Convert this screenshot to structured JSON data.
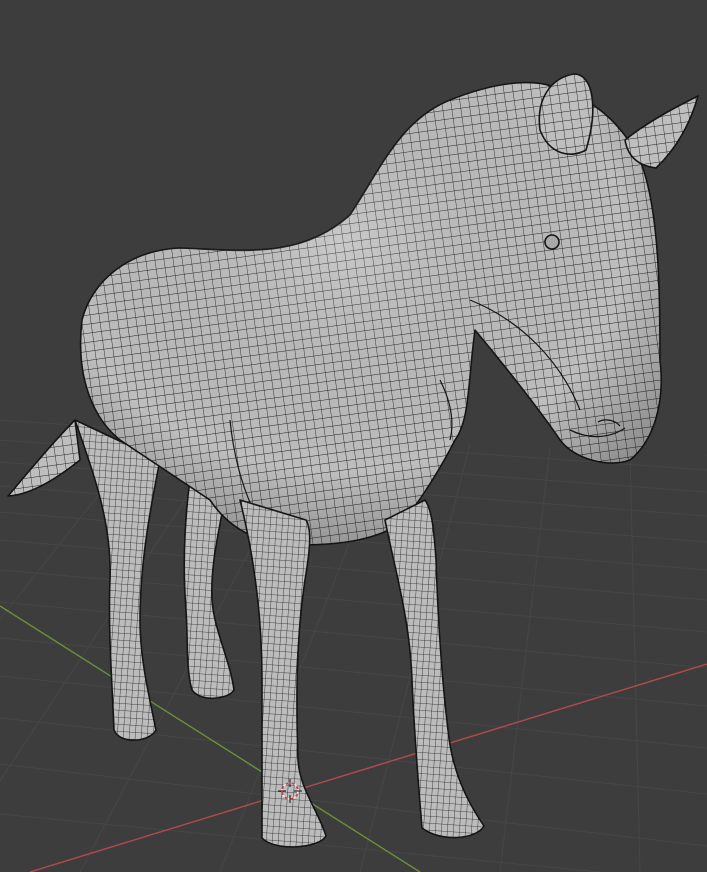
{
  "app": "Blender",
  "viewport": {
    "mode": "3d-viewport",
    "shading": "solid-wireframe",
    "background_color": "#3d3d3d",
    "floor_grid_color": "#4a4a4a",
    "x_axis_color": "#b34b4b",
    "y_axis_color": "#6b8f3a",
    "mesh_fill_color": "#bdbdbd",
    "wire_color": "#1c1c1c",
    "scene_object": "horse-mesh",
    "cursor_icon": "3d-cursor-icon"
  }
}
